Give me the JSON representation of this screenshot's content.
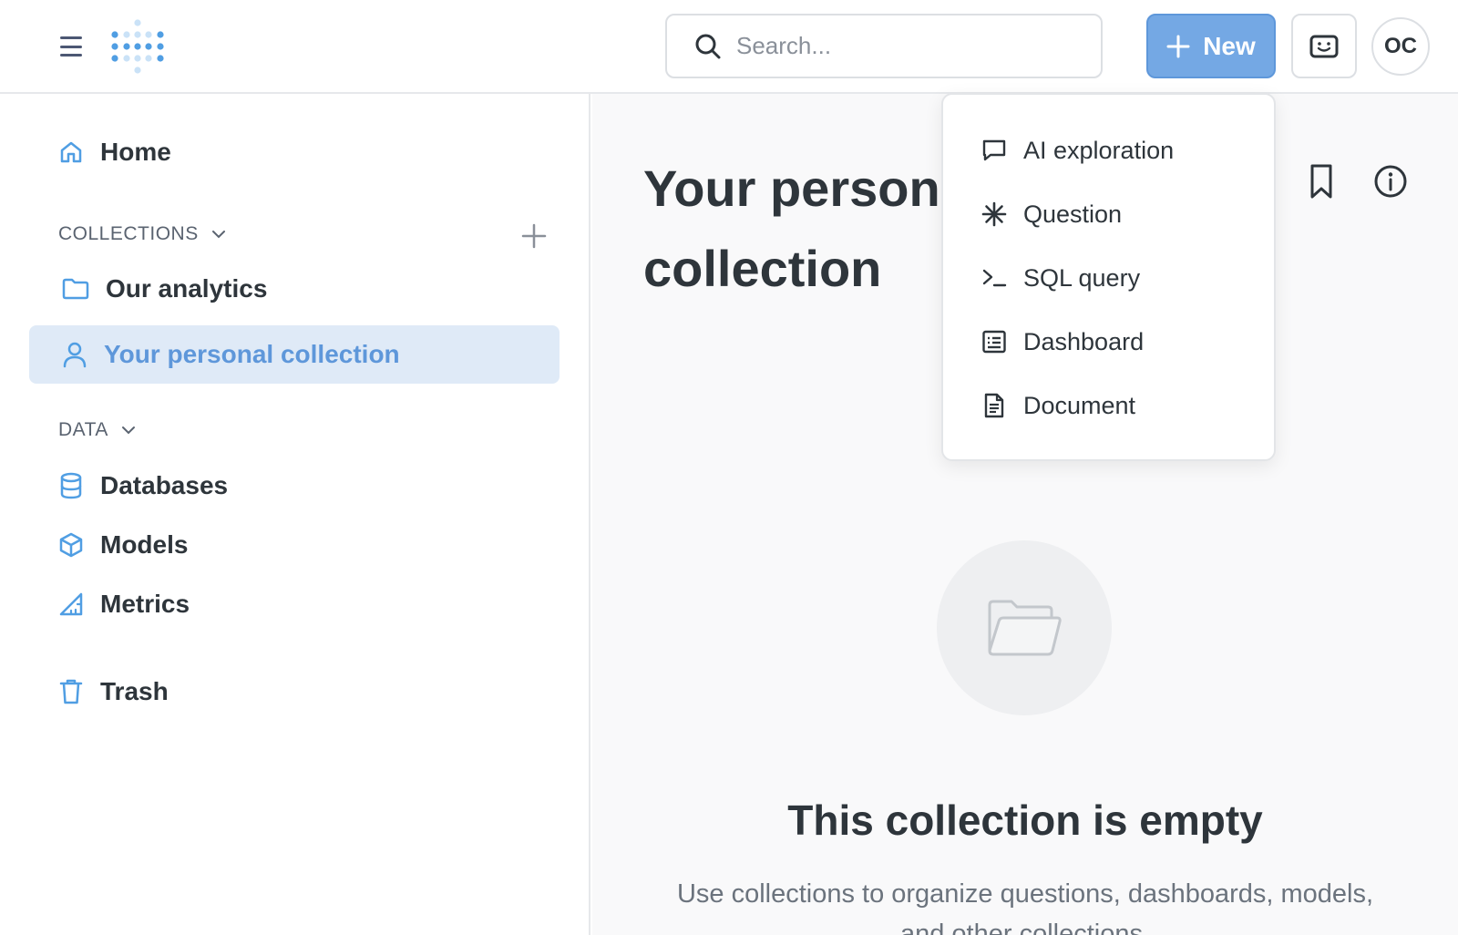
{
  "header": {
    "search_placeholder": "Search...",
    "new_label": "New",
    "avatar_initials": "OC"
  },
  "sidebar": {
    "home_label": "Home",
    "collections_label": "COLLECTIONS",
    "our_analytics_label": "Our analytics",
    "personal_collection_label": "Your personal collection",
    "data_label": "DATA",
    "databases_label": "Databases",
    "models_label": "Models",
    "metrics_label": "Metrics",
    "trash_label": "Trash"
  },
  "main": {
    "title": "Your personal collection",
    "empty_title": "This collection is empty",
    "empty_description": "Use collections to organize questions, dashboards, models, and other collections."
  },
  "new_menu": {
    "items": [
      {
        "label": "AI exploration",
        "icon": "chat-icon"
      },
      {
        "label": "Question",
        "icon": "asterisk-icon"
      },
      {
        "label": "SQL query",
        "icon": "terminal-icon"
      },
      {
        "label": "Dashboard",
        "icon": "dashboard-icon"
      },
      {
        "label": "Document",
        "icon": "document-icon"
      }
    ]
  },
  "colors": {
    "brand": "#509ee3",
    "new_button": "#74a8e4",
    "active_nav_bg": "#dfeaf7",
    "text_dark": "#2e353b"
  }
}
